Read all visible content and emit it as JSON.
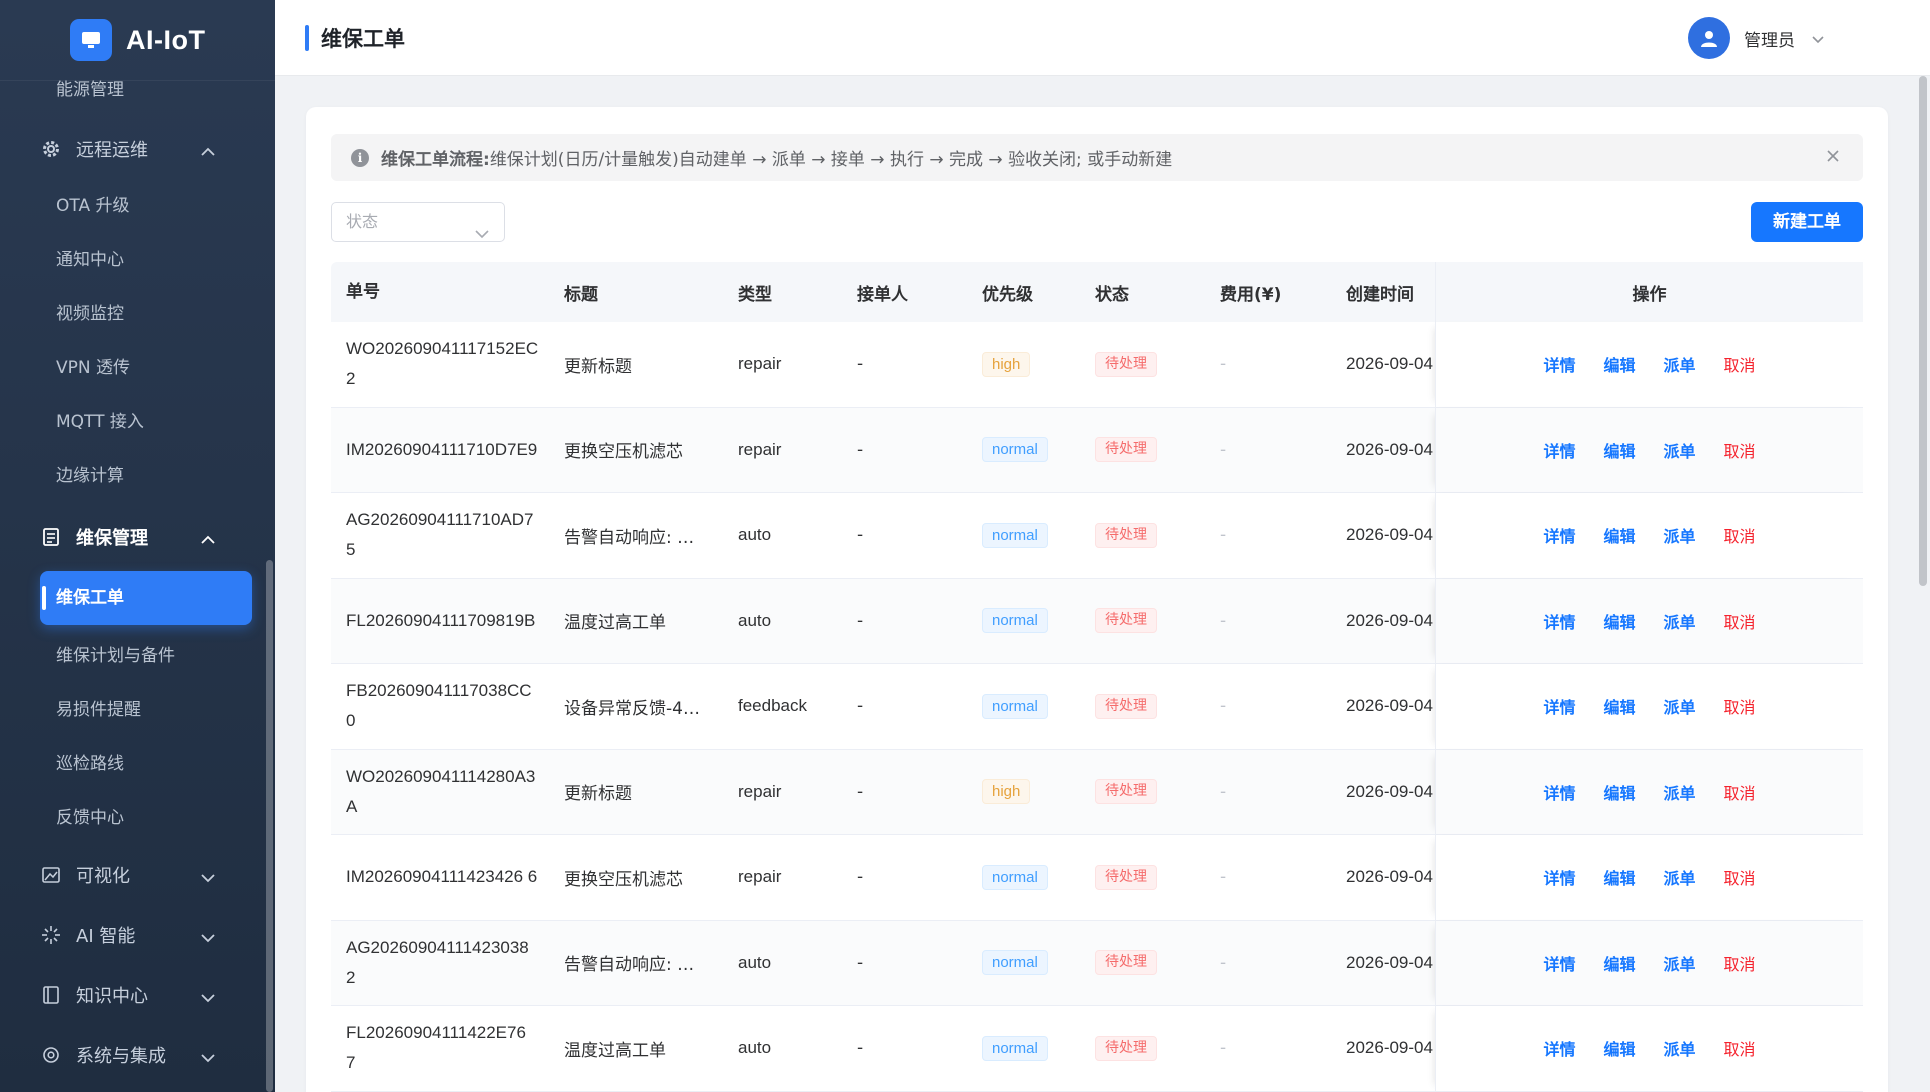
{
  "app": {
    "name": "AI-IoT"
  },
  "sidebar": {
    "top_item": "能源管理",
    "group_remote": {
      "label": "远程运维",
      "items": [
        "OTA 升级",
        "通知中心",
        "视频监控",
        "VPN 透传",
        "MQTT 接入",
        "边缘计算"
      ]
    },
    "group_maint": {
      "label": "维保管理",
      "selected": "维保工单",
      "items": [
        "维保计划与备件",
        "易损件提醒",
        "巡检路线",
        "反馈中心"
      ]
    },
    "group_visual": {
      "label": "可视化"
    },
    "group_ai": {
      "label": "AI 智能"
    },
    "group_knowledge": {
      "label": "知识中心"
    },
    "group_system": {
      "label": "系统与集成"
    }
  },
  "header": {
    "title": "维保工单",
    "user": "管理员"
  },
  "alert": {
    "title": "维保工单流程:",
    "text": "维保计划(日历/计量触发)自动建单 → 派单 → 接单 → 执行 → 完成 → 验收关闭; 或手动新建"
  },
  "filter": {
    "status_placeholder": "状态"
  },
  "toolbar": {
    "new_label": "新建工单"
  },
  "table": {
    "columns": {
      "no": "单号",
      "title": "标题",
      "type": "类型",
      "assignee": "接单人",
      "priority": "优先级",
      "status": "状态",
      "fee": "费用(¥)",
      "created": "创建时间",
      "ops": "操作"
    },
    "ops": {
      "detail": "详情",
      "edit": "编辑",
      "dispatch": "派单",
      "cancel": "取消"
    },
    "rows": [
      {
        "no": "WO202609041117152EC2",
        "title": "更新标题",
        "type": "repair",
        "assignee": "-",
        "priority": "high",
        "status": "待处理",
        "fee": "-",
        "created": "2026-09-04"
      },
      {
        "no": "IM20260904111710D7E9",
        "title": "更换空压机滤芯",
        "type": "repair",
        "assignee": "-",
        "priority": "normal",
        "status": "待处理",
        "fee": "-",
        "created": "2026-09-04"
      },
      {
        "no": "AG20260904111710AD75",
        "title": "告警自动响应: …",
        "type": "auto",
        "assignee": "-",
        "priority": "normal",
        "status": "待处理",
        "fee": "-",
        "created": "2026-09-04"
      },
      {
        "no": "FL20260904111709819B",
        "title": "温度过高工单",
        "type": "auto",
        "assignee": "-",
        "priority": "normal",
        "status": "待处理",
        "fee": "-",
        "created": "2026-09-04"
      },
      {
        "no": "FB202609041117038CC0",
        "title": "设备异常反馈-4…",
        "type": "feedback",
        "assignee": "-",
        "priority": "normal",
        "status": "待处理",
        "fee": "-",
        "created": "2026-09-04"
      },
      {
        "no": "WO202609041114280A3A",
        "title": "更新标题",
        "type": "repair",
        "assignee": "-",
        "priority": "high",
        "status": "待处理",
        "fee": "-",
        "created": "2026-09-04"
      },
      {
        "no": "IM20260904111423426 6",
        "title": "更换空压机滤芯",
        "type": "repair",
        "assignee": "-",
        "priority": "normal",
        "status": "待处理",
        "fee": "-",
        "created": "2026-09-04"
      },
      {
        "no": "AG20260904111423038 2",
        "title": "告警自动响应: …",
        "type": "auto",
        "assignee": "-",
        "priority": "normal",
        "status": "待处理",
        "fee": "-",
        "created": "2026-09-04"
      },
      {
        "no": "FL20260904111422E76 7",
        "title": "温度过高工单",
        "type": "auto",
        "assignee": "-",
        "priority": "normal",
        "status": "待处理",
        "fee": "-",
        "created": "2026-09-04"
      }
    ]
  }
}
